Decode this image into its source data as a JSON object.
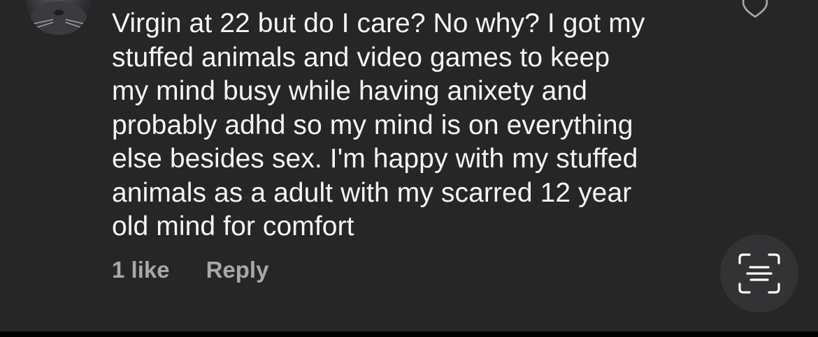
{
  "comment": {
    "text": "Virgin at 22 but do I care? No why? I got my\nstuffed animals and video games to keep\nmy mind busy while having anixety and\nprobably adhd so my mind is on everything\nelse besides sex. I'm happy with my stuffed\nanimals as a adult with my scarred 12 year\nold mind for comfort",
    "likes_label": "1 like",
    "reply_label": "Reply"
  },
  "icons": {
    "like": "heart-outline-icon",
    "scan": "scan-text-icon",
    "avatar": "cat-avatar"
  },
  "colors": {
    "background": "#262626",
    "text": "#f5f5f5",
    "secondary_text": "#a8a8a8",
    "floating_button": "#333335"
  }
}
